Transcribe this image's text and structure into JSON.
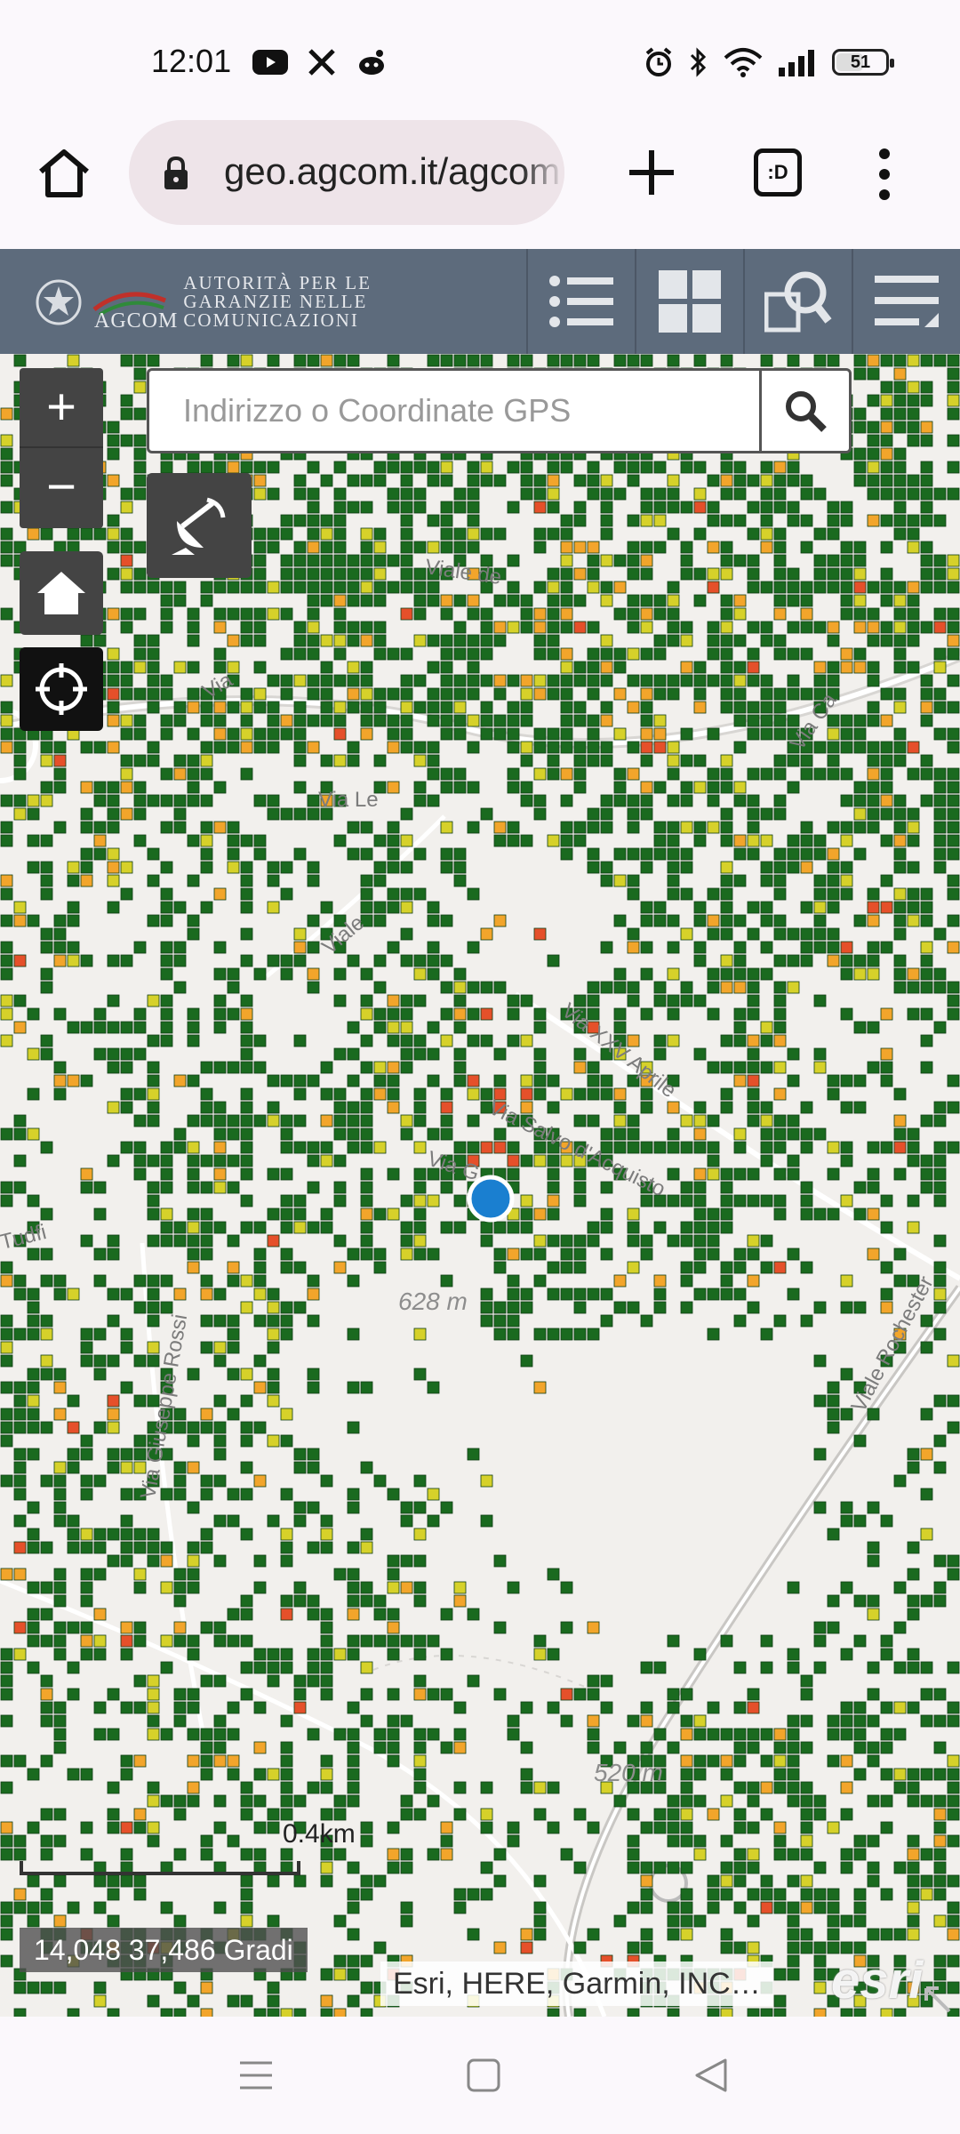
{
  "status_bar": {
    "time": "12:01",
    "battery": "51",
    "battery_level": 0.51,
    "icons": [
      "youtube-icon",
      "x-icon",
      "reddit-icon",
      "alarm-icon",
      "bluetooth-icon",
      "wifi-icon",
      "signal-icon",
      "battery-icon"
    ]
  },
  "browser": {
    "url": "geo.agcom.it/agcom",
    "tab_label": ":D"
  },
  "header": {
    "logo_line1": "AUTORITÀ PER LE",
    "logo_line2": "GARANZIE NELLE",
    "logo_line3": "COMUNICAZIONI",
    "logo_abbrev": "AGCOM"
  },
  "search": {
    "placeholder": "Indirizzo o Coordinate GPS"
  },
  "map": {
    "zoom_in": "+",
    "zoom_out": "−",
    "scale_label": "0.4km",
    "coordinates": "14,048 37,486 Gradi",
    "attribution": "Esri, HERE, Garmin, INC…",
    "esri_logo": "esri",
    "elevation_labels": [
      "628 m",
      "520 m"
    ],
    "street_labels": [
      "Viale de",
      "Via Ca",
      "Via Le",
      "Viale",
      "Via XXV Aprile",
      "Via Salvo d'Acquisto",
      "Viale Rochester",
      "Tudfi",
      "Via G",
      "Via Giuseppe Rossi",
      "Via"
    ],
    "colors": {
      "good": "#1a6a1f",
      "medium": "#d6d12a",
      "weak": "#f2a52b",
      "poor": "#e5502a",
      "location_dot": "#1a7fd0"
    }
  },
  "nav": {
    "icons": [
      "recent-apps-icon",
      "home-icon",
      "back-icon"
    ]
  }
}
